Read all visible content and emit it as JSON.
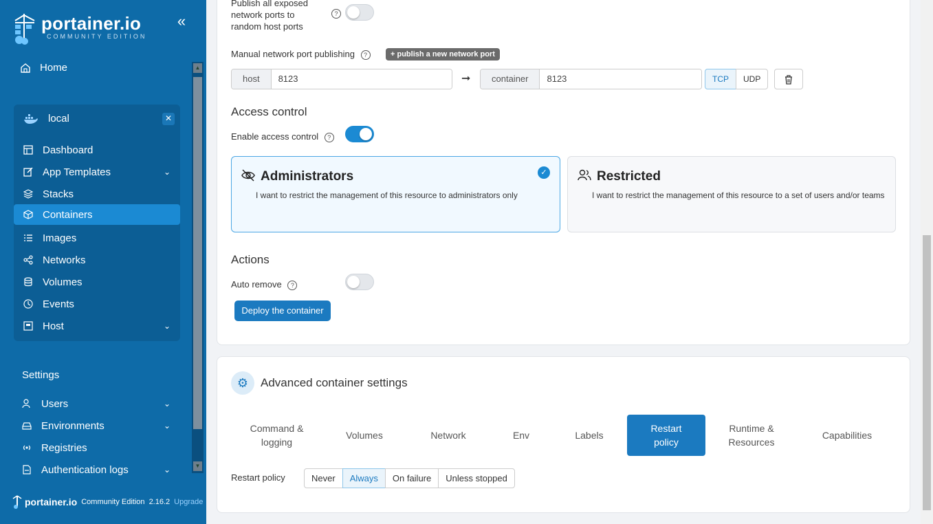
{
  "sidebar": {
    "logo_title": "portainer.io",
    "logo_sub": "COMMUNITY EDITION",
    "home": "Home",
    "env_name": "local",
    "env_items": [
      {
        "label": "Dashboard",
        "icon": "dashboard-icon"
      },
      {
        "label": "App Templates",
        "icon": "edit-icon",
        "chevron": true
      },
      {
        "label": "Stacks",
        "icon": "stacks-icon"
      },
      {
        "label": "Containers",
        "icon": "containers-icon",
        "active": true
      },
      {
        "label": "Images",
        "icon": "images-icon"
      },
      {
        "label": "Networks",
        "icon": "networks-icon"
      },
      {
        "label": "Volumes",
        "icon": "volumes-icon"
      },
      {
        "label": "Events",
        "icon": "events-icon"
      },
      {
        "label": "Host",
        "icon": "host-icon",
        "chevron": true
      }
    ],
    "settings_label": "Settings",
    "settings_items": [
      {
        "label": "Users"
      },
      {
        "label": "Environments"
      },
      {
        "label": "Registries"
      },
      {
        "label": "Authentication logs"
      }
    ],
    "footer_brand": "portainer.io",
    "footer_edition": "Community Edition",
    "footer_version": "2.16.2",
    "footer_upgrade": "Upgrade"
  },
  "ports": {
    "publish_all_label": "Publish all exposed network ports to random host ports",
    "manual_label": "Manual network port publishing",
    "publish_new_button": "+ publish a new network port",
    "host_addon": "host",
    "host_value": "8123",
    "container_addon": "container",
    "container_value": "8123",
    "tcp": "TCP",
    "udp": "UDP"
  },
  "access": {
    "title": "Access control",
    "enable_label": "Enable access control",
    "admin_title": "Administrators",
    "admin_desc": "I want to restrict the management of this resource to administrators only",
    "restricted_title": "Restricted",
    "restricted_desc": "I want to restrict the management of this resource to a set of users and/or teams"
  },
  "actions": {
    "title": "Actions",
    "auto_remove_label": "Auto remove",
    "deploy_button": "Deploy the container"
  },
  "advanced": {
    "title": "Advanced container settings",
    "tabs": [
      "Command & logging",
      "Volumes",
      "Network",
      "Env",
      "Labels",
      "Restart policy",
      "Runtime & Resources",
      "Capabilities"
    ],
    "restart_label": "Restart policy",
    "restart_options": [
      "Never",
      "Always",
      "On failure",
      "Unless stopped"
    ]
  },
  "colors": {
    "sidebar": "#0e6ba8",
    "accent": "#1b7ac0"
  }
}
